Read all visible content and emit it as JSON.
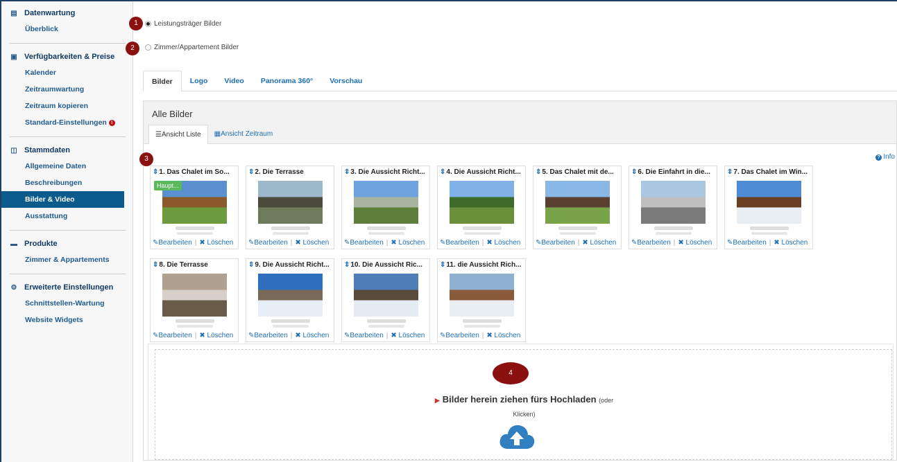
{
  "sidebar": {
    "sections": [
      {
        "title": "Datenwartung",
        "icon": "document-icon",
        "items": [
          {
            "label": "Überblick"
          }
        ]
      },
      {
        "title": "Verfügbarkeiten & Preise",
        "icon": "price-icon",
        "items": [
          {
            "label": "Kalender"
          },
          {
            "label": "Zeitraumwartung"
          },
          {
            "label": "Zeitraum kopieren"
          },
          {
            "label": "Standard-Einstellungen"
          }
        ]
      },
      {
        "title": "Stammdaten",
        "icon": "master-data-icon",
        "items": [
          {
            "label": "Allgemeine Daten"
          },
          {
            "label": "Beschreibungen"
          },
          {
            "label": "Bilder & Video"
          },
          {
            "label": "Ausstattung"
          }
        ]
      },
      {
        "title": "Produkte",
        "icon": "bed-icon",
        "items": [
          {
            "label": "Zimmer & Appartements"
          }
        ]
      },
      {
        "title": "Erweiterte Einstellungen",
        "icon": "cogs-icon",
        "items": [
          {
            "label": "Schnittstellen-Wartung"
          },
          {
            "label": "Website Widgets"
          }
        ]
      }
    ]
  },
  "badges": [
    "1",
    "2",
    "3",
    "4"
  ],
  "radios": {
    "option1": "Leistungsträger Bilder",
    "option2": "Zimmer/Appartement Bilder"
  },
  "tabs": [
    "Bilder",
    "Logo",
    "Video",
    "Panorama 360°",
    "Vorschau"
  ],
  "panel": {
    "title": "Alle Bilder",
    "subtab_list": "Ansicht Liste",
    "subtab_period": "Ansicht Zeitraum",
    "info": "Info"
  },
  "cards": [
    {
      "title": "1. Das Chalet im So...",
      "haupt": "Haupt..."
    },
    {
      "title": "2. Die Terrasse"
    },
    {
      "title": "3. Die Aussicht Richt..."
    },
    {
      "title": "4. Die Aussicht Richt..."
    },
    {
      "title": "5. Das Chalet mit de..."
    },
    {
      "title": "6. Die Einfahrt in die..."
    },
    {
      "title": "7. Das Chalet im Win..."
    },
    {
      "title": "8. Die Terrasse"
    },
    {
      "title": "9. Die Aussicht Richt..."
    },
    {
      "title": "10. Die Aussicht Ric..."
    },
    {
      "title": "11. die Aussicht Rich..."
    }
  ],
  "card_actions": {
    "edit": "Bearbeiten",
    "delete": "Löschen"
  },
  "dropzone": {
    "main": "Bilder herein ziehen fürs Hochladen",
    "small": "(oder",
    "click": "Klicken)"
  },
  "colors": {
    "accent": "#0d5a8c",
    "badge": "#8b1111",
    "link": "#1f6fb4",
    "haupt": "#5cb85c"
  }
}
